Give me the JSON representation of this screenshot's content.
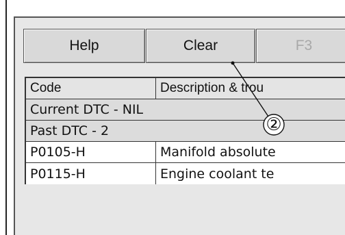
{
  "toolbar": {
    "help_label": "Help",
    "clear_label": "Clear",
    "f3_label": "F3"
  },
  "table": {
    "headers": [
      "Code",
      "Description & trou"
    ],
    "current_dtc": "Current DTC - NIL",
    "past_dtc": "Past DTC - 2",
    "rows": [
      {
        "code": "P0105-H",
        "description": "Manifold absolute"
      },
      {
        "code": "P0115-H",
        "description": "Engine coolant te"
      }
    ]
  },
  "callout": {
    "label": "②"
  }
}
